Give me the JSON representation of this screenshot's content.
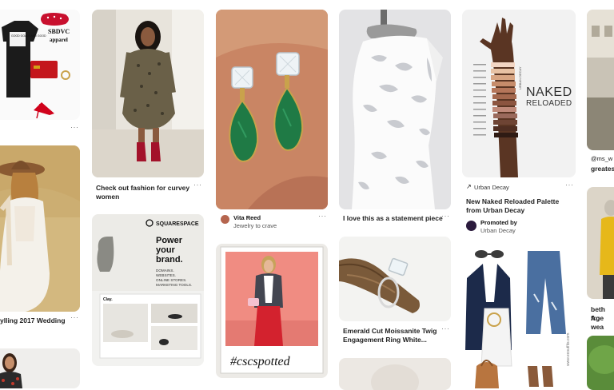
{
  "more_glyph": "···",
  "pins": {
    "fashion_collage": {
      "text_line1": "SBDVC",
      "text_line2": "apparel",
      "tee_text": "GOOD GOALS AND GOOD"
    },
    "curvy": {
      "caption_line1": "Check out fashion for curvey",
      "caption_line2": "women"
    },
    "earrings": {
      "user_name": "Vita Reed",
      "user_sub": "Jewelry to crave"
    },
    "dress": {
      "caption": "I love this as a statement piece"
    },
    "naked": {
      "brand_small": "URBAN DECAY",
      "title_line1": "NAKED",
      "title_line2": "RELOADED",
      "source_label": "Urban Decay",
      "caption_line1": "New Naked Reloaded Palette",
      "caption_line2": "from Urban Decay",
      "promoted_label": "Promoted by",
      "promoted_name": "Urban Decay"
    },
    "right_top": {
      "user_partial": "@ms_w",
      "caption_partial": "greatest"
    },
    "wedding": {
      "caption_partial": "ylling 2017 Wedding"
    },
    "squarespace": {
      "logo_text": "SQUARESPACE",
      "headline_1": "Power",
      "headline_2": "your",
      "headline_3": "brand.",
      "list_1": "DOMAINS.",
      "list_2": "WEBSITES.",
      "list_3": "ONLINE STORES.",
      "list_4": "MARKETING TOOLS.",
      "mock_brand": "Clay."
    },
    "polaroid": {
      "hashtag": "#cscspotted"
    },
    "ring": {
      "caption_line1": "Emerald Cut Moissanite Twig",
      "caption_line2": "Engagement Ring White..."
    },
    "outfit": {
      "watermark": "www.ecoutfits.com"
    },
    "right_bottom": {
      "caption_line1": "beth fro",
      "caption_line2": "Age wea"
    }
  },
  "colors": {
    "brand_red": "#e60023",
    "emerald": "#1f7a45",
    "text_grey": "#767676"
  }
}
